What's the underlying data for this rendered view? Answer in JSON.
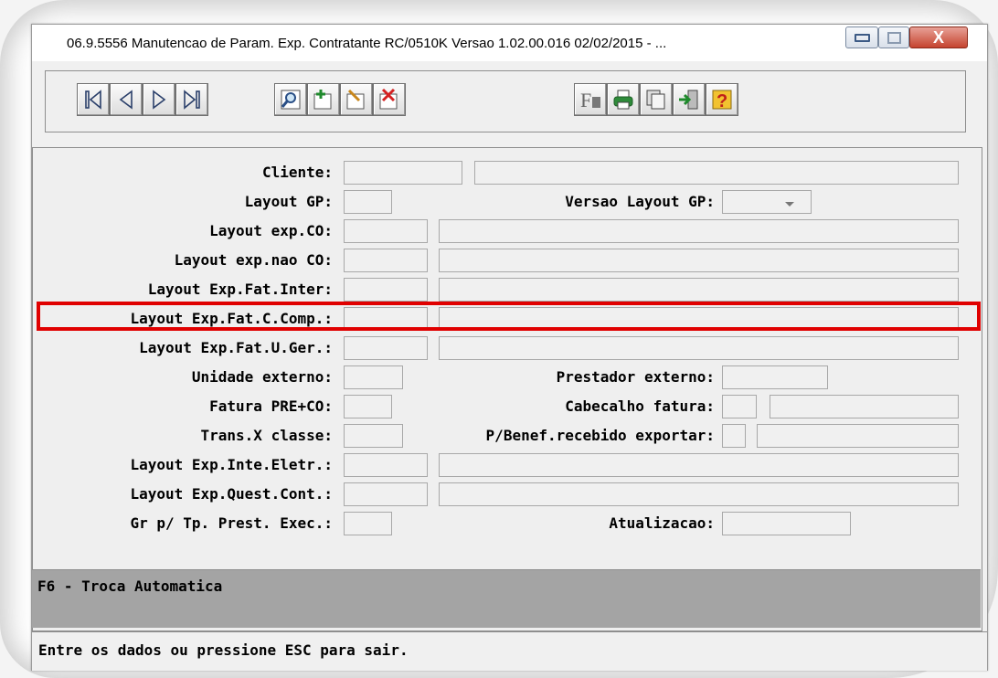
{
  "window": {
    "title": "06.9.5556 Manutencao  de Param. Exp. Contratante RC/0510K Versao 1.02.00.016 02/02/2015 - ...",
    "close_label": "X"
  },
  "toolbar": {
    "buttons": [
      {
        "name": "first-record-icon"
      },
      {
        "name": "previous-record-icon"
      },
      {
        "name": "next-record-icon"
      },
      {
        "name": "last-record-icon"
      },
      {
        "name": "search-icon"
      },
      {
        "name": "add-record-icon"
      },
      {
        "name": "edit-record-icon"
      },
      {
        "name": "delete-record-icon"
      },
      {
        "name": "filter-icon"
      },
      {
        "name": "print-icon"
      },
      {
        "name": "copy-icon"
      },
      {
        "name": "exit-icon"
      },
      {
        "name": "help-icon"
      }
    ],
    "filter_glyph": "F",
    "help_glyph": "?"
  },
  "form": {
    "labels": {
      "cliente": "Cliente:",
      "layout_gp": "Layout GP:",
      "versao_layout_gp": "Versao Layout GP:",
      "layout_exp_co": "Layout exp.CO:",
      "layout_exp_nao_co": "Layout exp.nao CO:",
      "layout_exp_fat_inter": "Layout Exp.Fat.Inter:",
      "layout_exp_fat_c_comp": "Layout Exp.Fat.C.Comp.:",
      "layout_exp_fat_u_ger": "Layout Exp.Fat.U.Ger.:",
      "unidade_externo": "Unidade externo:",
      "prestador_externo": "Prestador externo:",
      "fatura_pre_co": "Fatura PRE+CO:",
      "cabecalho_fatura": "Cabecalho fatura:",
      "trans_x_classe": "Trans.X classe:",
      "p_benef_recebido_exportar": "P/Benef.recebido exportar:",
      "layout_exp_inte_eletr": "Layout Exp.Inte.Eletr.:",
      "layout_exp_quest_cont": "Layout Exp.Quest.Cont.:",
      "gr_tp_prest_exec": "Gr p/ Tp. Prest. Exec.:",
      "atualizacao": "Atualizacao:"
    }
  },
  "status": {
    "hint": "F6 - Troca Automatica",
    "message": "Entre os dados ou pressione ESC para sair."
  },
  "colors": {
    "highlight": "#e00000"
  }
}
